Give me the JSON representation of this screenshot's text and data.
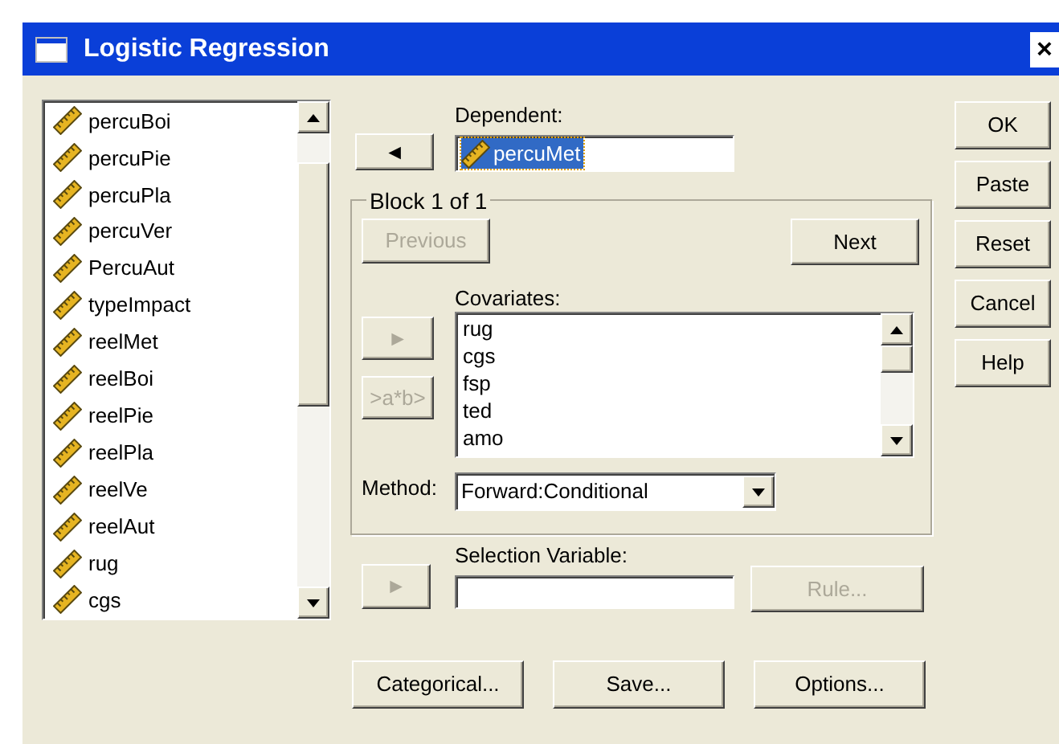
{
  "window": {
    "title": "Logistic Regression",
    "close": "×"
  },
  "variables": [
    {
      "name": "percuBoi"
    },
    {
      "name": "percuPie"
    },
    {
      "name": "percuPla"
    },
    {
      "name": "percuVer"
    },
    {
      "name": "PercuAut"
    },
    {
      "name": "typeImpact"
    },
    {
      "name": "reelMet"
    },
    {
      "name": "reelBoi"
    },
    {
      "name": "reelPie"
    },
    {
      "name": "reelPla"
    },
    {
      "name": "reelVe"
    },
    {
      "name": "reelAut"
    },
    {
      "name": "rug"
    },
    {
      "name": "cgs"
    }
  ],
  "dependent": {
    "move_button": {
      "label": "◄",
      "disabled": false
    },
    "label": "Dependent:",
    "value": "percuMet",
    "selected": true
  },
  "block": {
    "legend": "Block 1 of 1",
    "previous": {
      "label": "Previous",
      "disabled": true
    },
    "next": {
      "label": "Next",
      "disabled": false
    },
    "move_button": {
      "label": "►",
      "disabled": true
    },
    "interaction_button": {
      "label": ">a*b>",
      "disabled": true
    },
    "covariates_label": "Covariates:",
    "covariates": [
      "rug",
      "cgs",
      "fsp",
      "ted",
      "amo"
    ],
    "method_label": "Method:",
    "method": "Forward:Conditional"
  },
  "selection": {
    "move_button": {
      "label": "►",
      "disabled": true
    },
    "label": "Selection Variable:",
    "rule": {
      "label": "Rule...",
      "disabled": true
    }
  },
  "bottom_buttons": [
    {
      "label": "Categorical...",
      "disabled": false
    },
    {
      "label": "Save...",
      "disabled": false
    },
    {
      "label": "Options...",
      "disabled": false
    }
  ],
  "side_buttons": [
    {
      "label": "OK",
      "disabled": false
    },
    {
      "label": "Paste",
      "disabled": false
    },
    {
      "label": "Reset",
      "disabled": false
    },
    {
      "label": "Cancel",
      "disabled": false
    },
    {
      "label": "Help",
      "disabled": false
    }
  ]
}
